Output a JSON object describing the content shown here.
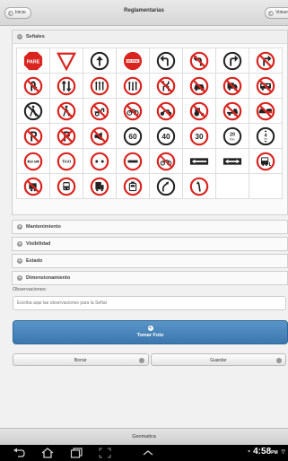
{
  "header": {
    "home_label": "Inicio",
    "title": "Reglamentarias",
    "back_label": "Volver"
  },
  "signs_section": {
    "title": "Señales",
    "collapse_symbol": "−"
  },
  "sign_labels": {
    "pare": "PARE",
    "no_pase": "NO PASE",
    "speed_60": "60",
    "speed_40": "40",
    "speed_30": "30",
    "weight_top": "20",
    "weight_bottom": "Ton.",
    "height_top": "4",
    "height_bottom": "m",
    "taxi": "TAXI",
    "distance": "30 M"
  },
  "collapsible_sections": [
    {
      "title": "Mantenimiento"
    },
    {
      "title": "Visibilidad"
    },
    {
      "title": "Estado"
    },
    {
      "title": "Dimensionamiento"
    }
  ],
  "observations": {
    "label": "Observaciones:",
    "placeholder": "Escriba aqui las observaciones para la Señal"
  },
  "photo_button": {
    "label": "Tomar Foto"
  },
  "actions": {
    "delete_label": "Borrar",
    "save_label": "Guardar"
  },
  "footer": {
    "label": "Geomatica"
  },
  "status": {
    "time": "4:58",
    "ampm": "PM"
  },
  "colors": {
    "sign_red": "#d9241f",
    "accent_blue": "#3b77ae"
  }
}
